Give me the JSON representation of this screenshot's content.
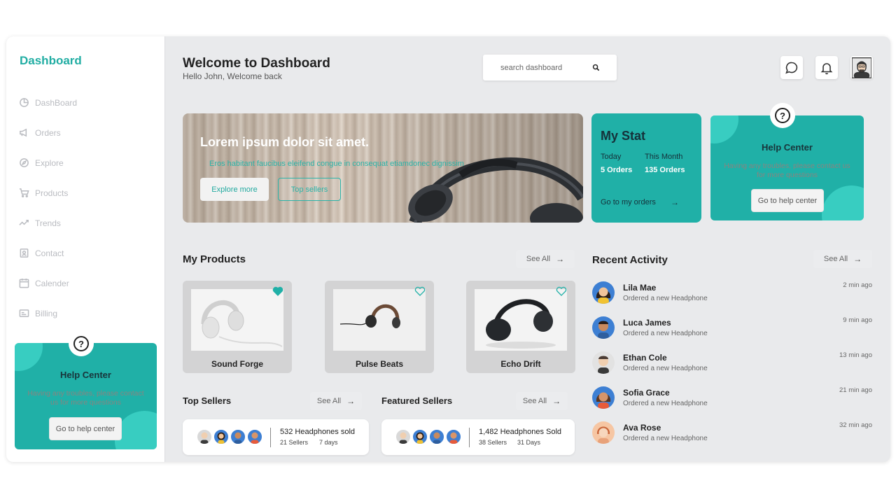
{
  "sidebar": {
    "brand": "Dashboard",
    "items": [
      {
        "label": "DashBoard",
        "icon": "pie-chart-icon"
      },
      {
        "label": "Orders",
        "icon": "megaphone-icon"
      },
      {
        "label": "Explore",
        "icon": "compass-icon"
      },
      {
        "label": "Products",
        "icon": "cart-icon"
      },
      {
        "label": "Trends",
        "icon": "trend-icon"
      },
      {
        "label": "Contact",
        "icon": "contact-icon"
      },
      {
        "label": "Calender",
        "icon": "calendar-icon"
      },
      {
        "label": "Billing",
        "icon": "billing-icon"
      }
    ],
    "help": {
      "title": "Help Center",
      "text": "Having any troubles, please contact us for more questions",
      "button": "Go to help center"
    }
  },
  "header": {
    "title": "Welcome to Dashboard",
    "subtitle": "Hello John, Welcome back",
    "search_placeholder": "search dashboard"
  },
  "hero": {
    "title": "Lorem ipsum dolor sit amet.",
    "subtitle": "Eros habitant faucibus eleifend congue in consequat etiamdonec dignissim",
    "primary_button": "Explore more",
    "secondary_button": "Top sellers"
  },
  "stat": {
    "title": "My Stat",
    "today_label": "Today",
    "month_label": "This Month",
    "today_value": "5 Orders",
    "month_value": "135 Orders",
    "link": "Go to my orders"
  },
  "help_card": {
    "title": "Help Center",
    "text": "Having any troubles, please contact us for more questions",
    "button": "Go to help center"
  },
  "products": {
    "title": "My Products",
    "see_all": "See All",
    "items": [
      {
        "name": "Sound Forge",
        "favorited": true
      },
      {
        "name": "Pulse Beats",
        "favorited": false
      },
      {
        "name": "Echo Drift",
        "favorited": false
      }
    ]
  },
  "top_sellers": {
    "title": "Top Sellers",
    "see_all": "See All",
    "main": "532 Headphones sold",
    "sellers": "21 Sellers",
    "period": "7 days"
  },
  "featured_sellers": {
    "title": "Featured Sellers",
    "see_all": "See All",
    "main": "1,482 Headphones Sold",
    "sellers": "38 Sellers",
    "period": "31 Days"
  },
  "activity": {
    "title": "Recent Activity",
    "see_all": "See All",
    "items": [
      {
        "name": "Lila Mae",
        "desc": "Ordered a new Headphone",
        "time": "2 min ago"
      },
      {
        "name": "Luca James",
        "desc": "Ordered a new Headphone",
        "time": "9 min ago"
      },
      {
        "name": "Ethan Cole",
        "desc": "Ordered a new Headphone",
        "time": "13 min ago"
      },
      {
        "name": "Sofia Grace",
        "desc": "Ordered a new Headphone",
        "time": "21 min ago"
      },
      {
        "name": "Ava Rose",
        "desc": "Ordered a new Headphone",
        "time": "32 min ago"
      }
    ]
  },
  "colors": {
    "accent": "#20b0a7",
    "accent_light": "#3fd4c8",
    "background": "#e9eaec"
  }
}
